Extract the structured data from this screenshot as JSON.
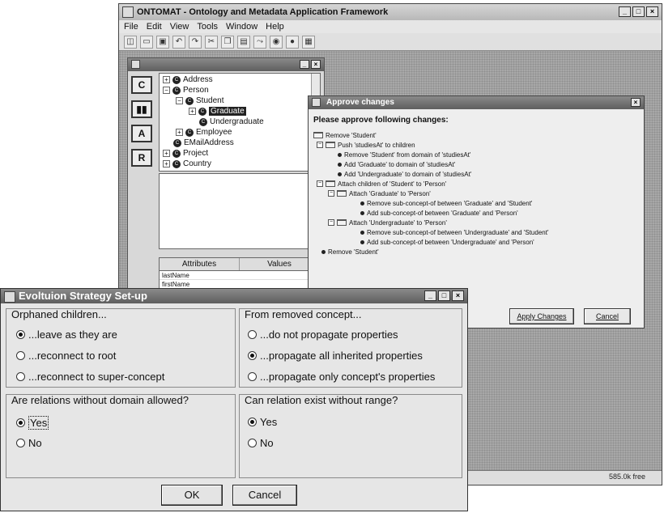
{
  "main_window": {
    "title": "ONTOMAT - Ontology and Metadata Application Framework",
    "menu": [
      "File",
      "Edit",
      "View",
      "Tools",
      "Window",
      "Help"
    ],
    "status_memory": "585.0k free"
  },
  "explorer": {
    "tree": [
      {
        "label": "Address",
        "expander": "+"
      },
      {
        "label": "Person",
        "expander": "−"
      },
      {
        "label": "Student",
        "expander": "−"
      },
      {
        "label": "Graduate",
        "expander": "+"
      },
      {
        "label": "Undergraduate",
        "expander": ""
      },
      {
        "label": "Employee",
        "expander": "+"
      },
      {
        "label": "EMailAddress",
        "expander": ""
      },
      {
        "label": "Project",
        "expander": "+"
      },
      {
        "label": "Country",
        "expander": "+"
      }
    ],
    "attributes_header": "Attributes",
    "values_header": "Values",
    "attribute_rows": [
      "lastName",
      "firstName"
    ]
  },
  "approve_dialog": {
    "title": "Approve changes",
    "heading": "Please approve following changes:",
    "items": [
      "Remove 'Student'",
      "Push 'studiesAt' to children",
      "Remove 'Student' from domain of 'studiesAt'",
      "Add 'Graduate' to domain of 'studiesAt'",
      "Add 'Undergraduate' to domain of 'studiesAt'",
      "Attach children of 'Student' to 'Person'",
      "Attach 'Graduate' to 'Person'",
      "Remove sub-concept-of between 'Graduate' and 'Student'",
      "Add sub-concept-of between 'Graduate' and 'Person'",
      "Attach 'Undergraduate' to 'Person'",
      "Remove sub-concept-of between 'Undergraduate' and 'Student'",
      "Add sub-concept-of between 'Undergraduate' and 'Person'",
      "Remove 'Student'"
    ],
    "apply_label": "Apply Changes",
    "cancel_label": "Cancel"
  },
  "evolution_dialog": {
    "title": "Evoltuion Strategy Set-up",
    "orphaned": {
      "title": "Orphaned children...",
      "options": [
        "...leave as they are",
        "...reconnect to root",
        "...reconnect to super-concept"
      ],
      "selected": 0
    },
    "removed_concept": {
      "title": "From removed concept...",
      "options": [
        "...do not propagate properties",
        "...propagate all inherited properties",
        "...propagate only concept's properties"
      ],
      "selected": 1
    },
    "relations_domain": {
      "title": "Are relations without domain allowed?",
      "options": [
        "Yes",
        "No"
      ],
      "selected": 0
    },
    "relations_range": {
      "title": "Can relation exist without range?",
      "options": [
        "Yes",
        "No"
      ],
      "selected": 0
    },
    "ok_label": "OK",
    "cancel_label": "Cancel"
  }
}
